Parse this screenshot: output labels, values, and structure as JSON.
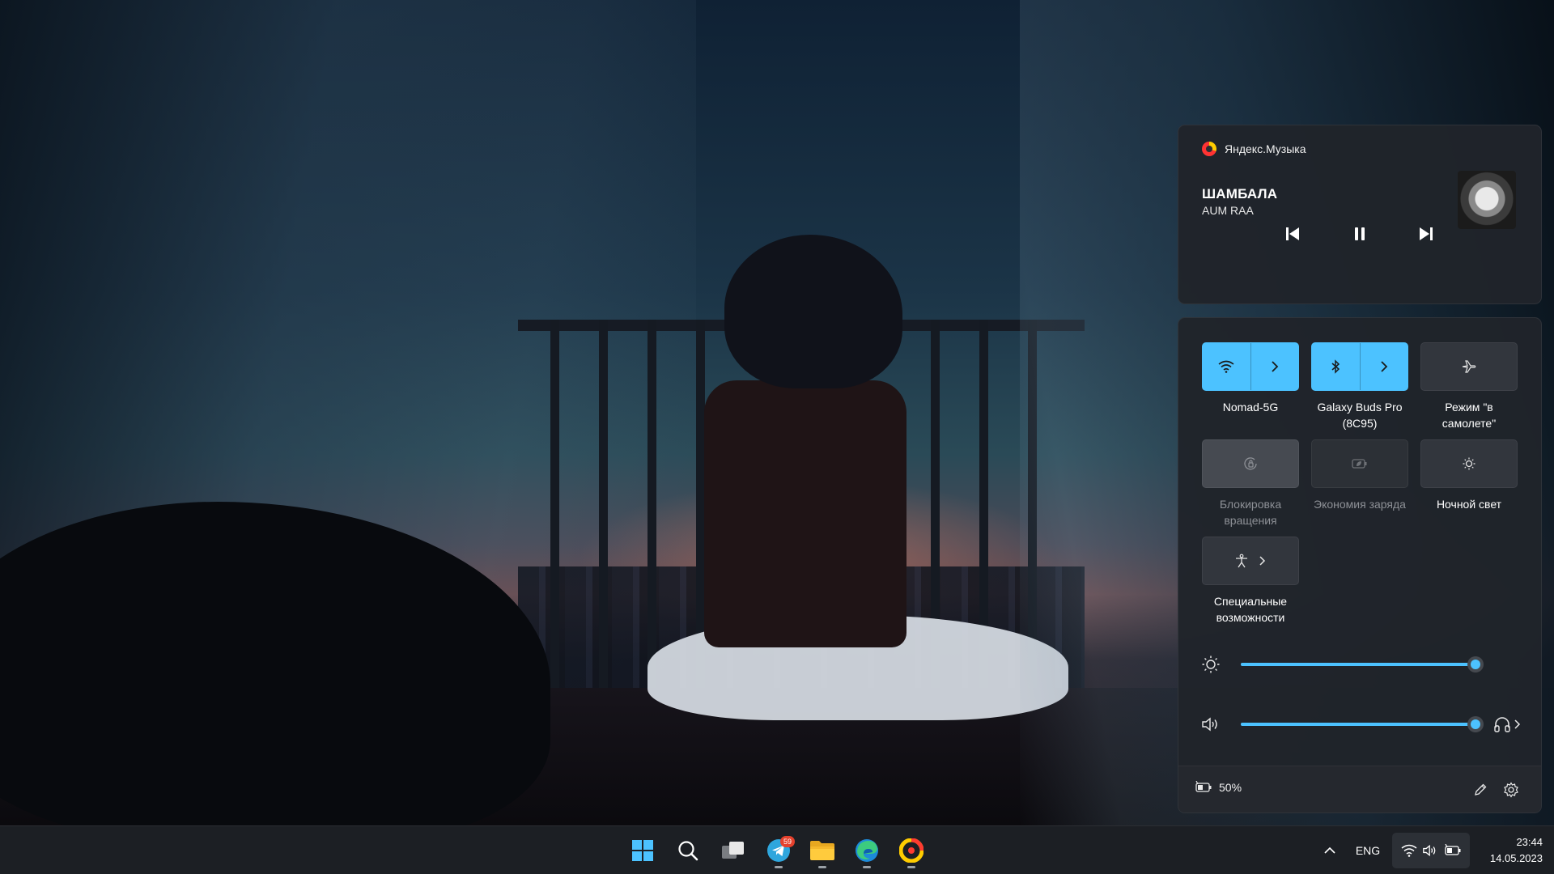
{
  "media": {
    "app_name": "Яндекс.Музыка",
    "track_title": "ШАМБАЛА",
    "track_artist": "AUM RAA",
    "controls": [
      "previous",
      "pause",
      "next"
    ]
  },
  "quick_settings": {
    "tiles": [
      {
        "id": "wifi",
        "label": "Nomad-5G",
        "icon": "wifi-icon",
        "state": "on",
        "has_chevron": true
      },
      {
        "id": "bluetooth",
        "label": "Galaxy Buds Pro (8C95)",
        "icon": "bluetooth-icon",
        "state": "on",
        "has_chevron": true
      },
      {
        "id": "airplane",
        "label": "Режим \"в самолете\"",
        "icon": "airplane-icon",
        "state": "off"
      },
      {
        "id": "rotation",
        "label": "Блокировка вращения",
        "icon": "rotation-lock-icon",
        "state": "disabled"
      },
      {
        "id": "battery-saver",
        "label": "Экономия заряда",
        "icon": "battery-saver-icon",
        "state": "disabled"
      },
      {
        "id": "night-light",
        "label": "Ночной свет",
        "icon": "night-light-icon",
        "state": "off"
      },
      {
        "id": "accessibility",
        "label": "Специальные возможности",
        "icon": "accessibility-icon",
        "state": "off",
        "has_chevron": true
      }
    ],
    "brightness": {
      "level": 100,
      "icon": "sun-icon"
    },
    "volume": {
      "level": 100,
      "icon": "speaker-icon",
      "output_icon": "headphones-icon"
    },
    "battery_percent": "50%"
  },
  "taskbar": {
    "apps": [
      "start",
      "search",
      "task-view",
      "telegram",
      "file-explorer",
      "edge",
      "yandex-music"
    ],
    "telegram_badge": "59",
    "language": "ENG",
    "time": "23:44",
    "date": "14.05.2023"
  },
  "colors": {
    "accent": "#4cc2ff",
    "panel": "#20242a",
    "taskbar": "#1c1f24"
  }
}
